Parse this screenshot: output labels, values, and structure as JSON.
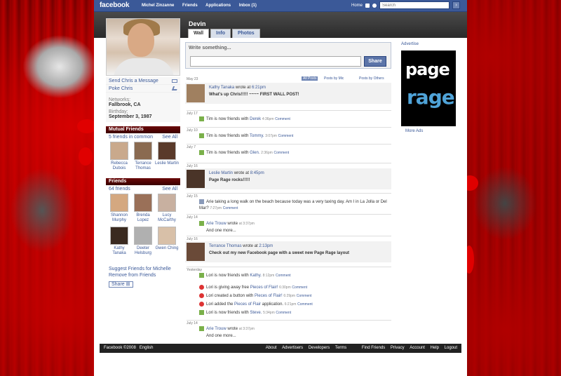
{
  "topbar": {
    "logo": "facebook",
    "nav": [
      "Michel Zinzanne",
      "Friends",
      "Applications",
      "Inbox (1)"
    ],
    "home": "Home",
    "search_placeholder": "Search"
  },
  "profile": {
    "name": "Devin",
    "tabs": [
      "Wall",
      "Info",
      "Photos"
    ],
    "actions": [
      "Send Chris a Message",
      "Poke Chris"
    ],
    "networks_label": "Networks:",
    "networks_value": "Fallbrook, CA",
    "birthday_label": "Birthday:",
    "birthday_value": "September 3, 1987"
  },
  "mutual": {
    "title": "Mutual Friends",
    "count": "5 friends in common",
    "see_all": "See All",
    "friends": [
      {
        "name": "Rebecca Dubois"
      },
      {
        "name": "Terrance Thomas"
      },
      {
        "name": "Leslie Martin"
      }
    ]
  },
  "friends": {
    "title": "Friends",
    "count": "64 friends",
    "see_all": "See All",
    "list": [
      {
        "name": "Shannon Murphy"
      },
      {
        "name": "Brenda Lopez"
      },
      {
        "name": "Lucy McCarthy"
      },
      {
        "name": "Kathy Tanaka"
      },
      {
        "name": "Deeter Helsburg"
      },
      {
        "name": "Gwen Ching"
      }
    ]
  },
  "suggest": {
    "suggest_link": "Suggest Friends for Michelle",
    "remove_link": "Remove from Friends",
    "share": "Share"
  },
  "composer": {
    "prompt": "Write something...",
    "button": "Share"
  },
  "filters": {
    "date": "May 23",
    "all": "All Posts",
    "mic": "Posts by Mic",
    "others": "Posts by Others"
  },
  "feed": {
    "p1_author": "Kathy Tanaka",
    "p1_wrote": "wrote at",
    "p1_time": "6:21pm",
    "p1_body": "What's up Chris!!!!! ~~~~ FIRST WALL POST!",
    "d1": "July 17",
    "m1": "Tim is now friends with",
    "m1_who": "Derek",
    "m1_time": "4:36pm",
    "comment": "Comment",
    "d2": "July 10",
    "m2_who": "Tommy.",
    "m2_time": "3:07pm",
    "d3": "July 7",
    "m3_who": "Glen.",
    "m3_time": "2:36pm",
    "d4": "July 16",
    "p2_author": "Leslie Martin",
    "p2_wrote": "wrote at",
    "p2_time": "8:45pm",
    "p2_body": "Page Rage rocks!!!!!",
    "d5": "July 15",
    "m4_text": "Arie taking a long walk on the beach because today was a very taxing day. Am I in La Jolla or Del Mar?",
    "m4_time": "7:27pm",
    "d6": "July 14",
    "m5_author": "Arie Trouw",
    "m5_wrote": "wrote",
    "m5_time": "at 3:37pm",
    "m5_more": "And one more...",
    "d7": "July 16",
    "p3_author": "Terrance Thomas",
    "p3_wrote": "wrote at",
    "p3_time": "2:13pm",
    "p3_body": "Check out my new Facebook page with a sweet new Page Rage layout",
    "d8": "Yesterday",
    "y1": "Lori is now friends with",
    "y1_who": "Kathy.",
    "y1_time": "8:12pm",
    "y2": "Lori is giving away free",
    "y2_link": "Pieces of Flair!",
    "y2_time": "6:30pm",
    "y3": "Lori created a button with",
    "y3_link": "Pieces of Flair!",
    "y3_time": "6:29pm",
    "y4": "Lori added the",
    "y4_link": "Pieces of Flair",
    "y4_tail": "application.",
    "y4_time": "6:21pm",
    "y5": "Lori is now friends with",
    "y5_who": "Steve.",
    "y5_time": "5:34pm",
    "d9": "July 14",
    "m6_author": "Arie Trouw",
    "m6_wrote": "wrote",
    "m6_time": "at 3:37pm",
    "m6_more": "And one more..."
  },
  "right": {
    "advertise": "Advertise",
    "ad_line1": "page",
    "ad_line2": "rage",
    "more_ads": "More Ads"
  },
  "footer": {
    "left": "Facebook ©2008",
    "lang": "English",
    "links": [
      "About",
      "Advertisers",
      "Developers",
      "Terms",
      "Find Friends",
      "Privacy",
      "Account",
      "Help",
      "Logout"
    ]
  },
  "colors": {
    "fb_blue": "#3b5998",
    "band": "#333333",
    "link": "#3b5998",
    "background": "#8b0000"
  }
}
